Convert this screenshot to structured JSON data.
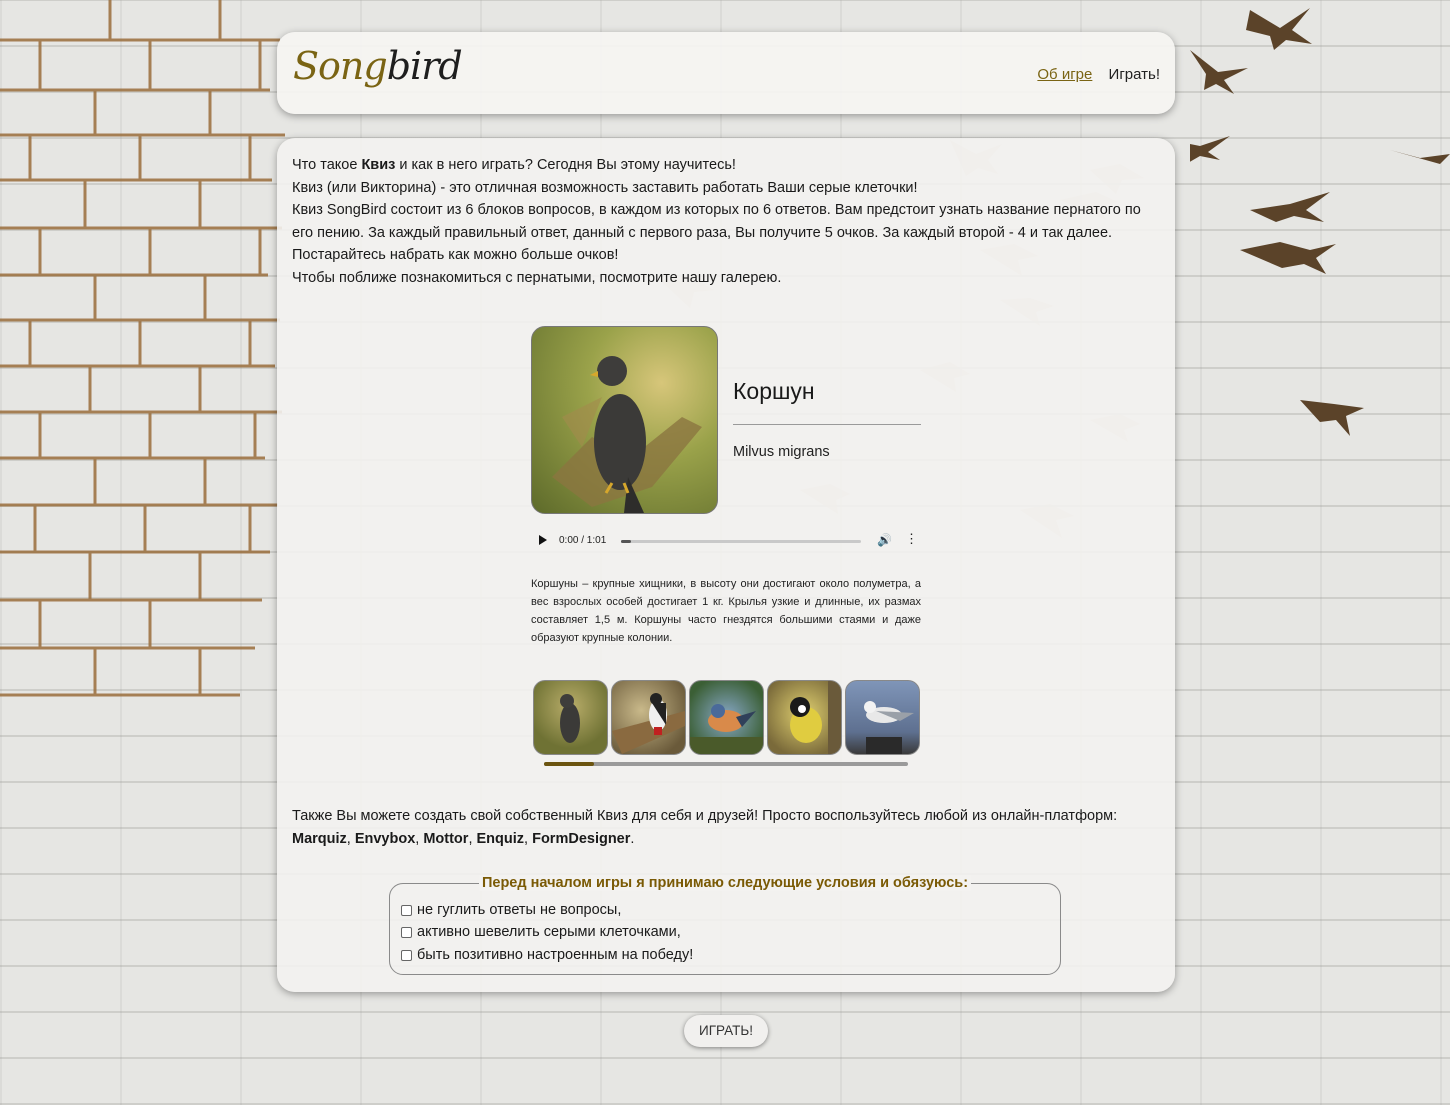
{
  "header": {
    "logo_song": "Song",
    "logo_bird": "bird",
    "nav_about": "Об игре",
    "nav_play": "Играть!"
  },
  "intro": {
    "line1_a": "Что такое ",
    "line1_b": "Квиз",
    "line1_c": " и как в него играть? Сегодня Вы этому научитесь!",
    "line2": "Квиз (или Викторина) - это отличная возможность заставить работать Ваши серые клеточки!",
    "line3": "Квиз SongBird состоит из 6 блоков вопросов, в каждом из которых по 6 ответов. Вам предстоит узнать название пернатого по его пению. За каждый правильный ответ, данный с первого раза, Вы получите 5 очков. За каждый второй - 4 и так далее. Постарайтесь набрать как можно больше очков!",
    "line4": "Чтобы поближе познакомиться с пернатыми, посмотрите нашу галерею."
  },
  "bird": {
    "name": "Коршун",
    "latin": "Milvus migrans",
    "description": "Коршуны – крупные хищники, в высоту они достигают около полуметра, а вес взрослых особей достигает 1 кг. Крылья узкие и длинные, их размах составляет 1,5 м. Коршуны часто гнездятся большими стаями и даже образуют крупные колонии."
  },
  "audio": {
    "time": "0:00 / 1:01",
    "progress": 0.0
  },
  "gallery": {
    "thumbs": [
      "kite-thumb",
      "woodpecker-thumb",
      "finch-thumb",
      "tit-thumb",
      "gull-thumb"
    ],
    "scroll_position": 0.0
  },
  "extra": {
    "text": "Также Вы можете создать свой собственный Квиз для себя и друзей! Просто воспользуйтесь любой из онлайн-платформ:",
    "platforms": [
      "Marquiz",
      "Envybox",
      "Mottor",
      "Enquiz",
      "FormDesigner"
    ],
    "sep": ", ",
    "end": "."
  },
  "conditions": {
    "legend": "Перед началом игры я принимаю следующие условия и обязуюсь:",
    "items": [
      "не гуглить ответы не вопросы,",
      "активно шевелить серыми клеточками,",
      "быть позитивно настроенным на победу!"
    ]
  },
  "play_button": "ИГРАТЬ!",
  "colors": {
    "accent": "#7a6414",
    "legend": "#7a5a05",
    "bird_silhouette": "#5b4329"
  }
}
